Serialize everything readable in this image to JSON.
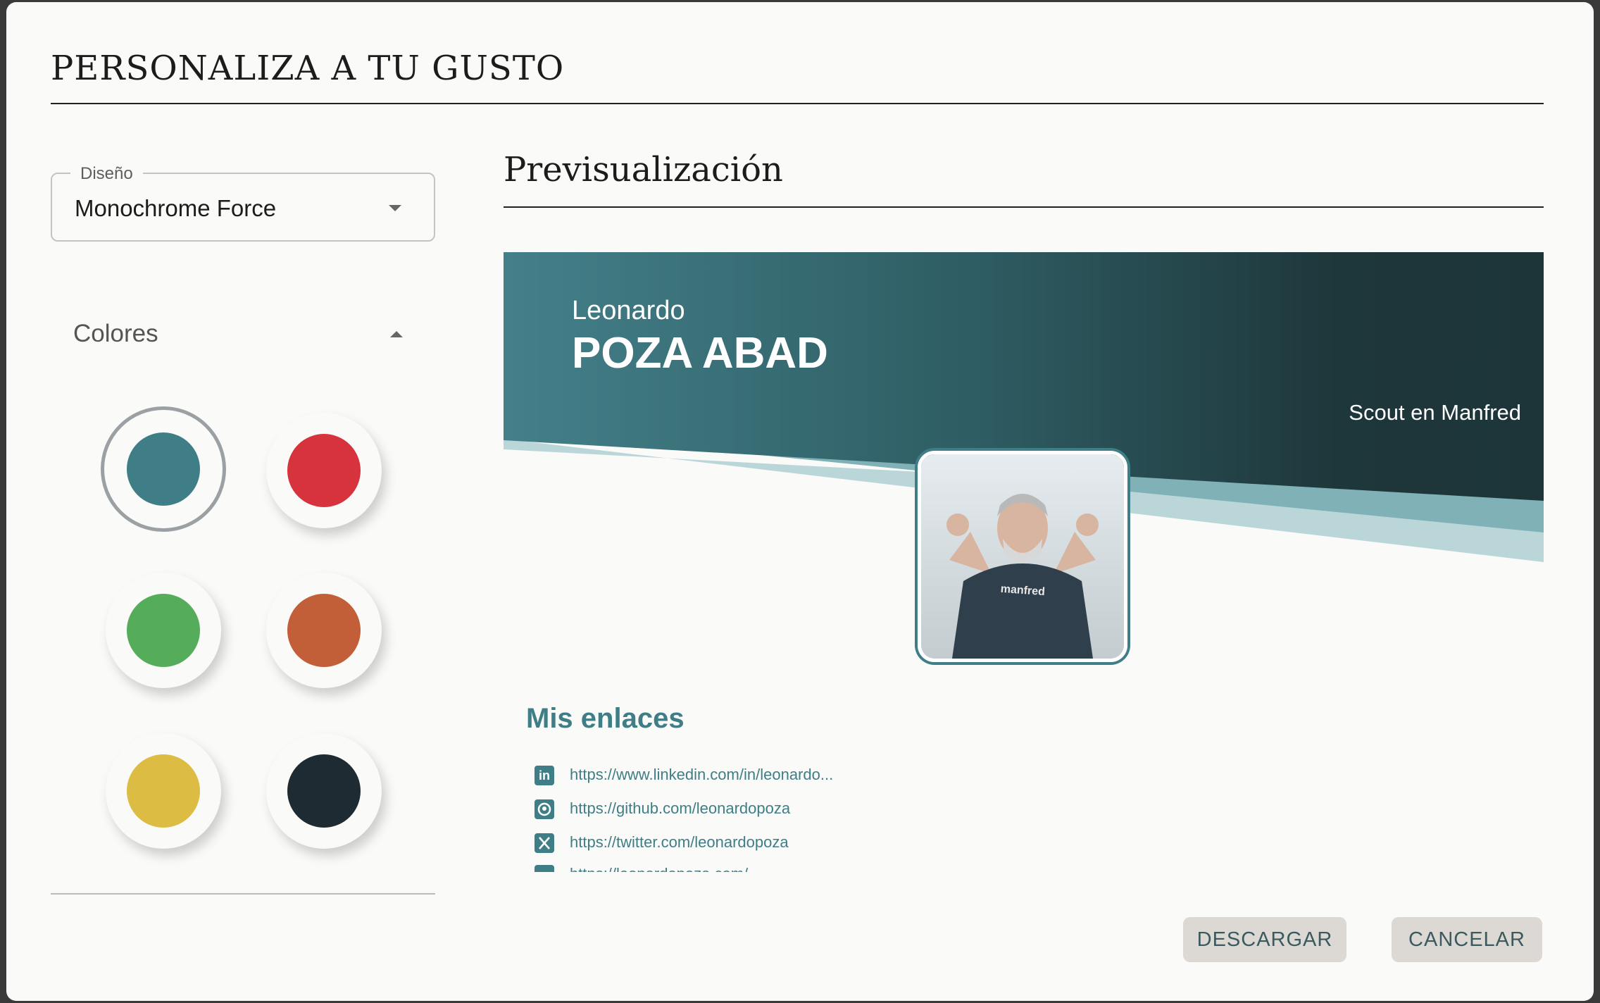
{
  "dialog": {
    "title": "PERSONALIZA A TU GUSTO"
  },
  "design_select": {
    "label": "Diseño",
    "value": "Monochrome Force"
  },
  "colors": {
    "title": "Colores",
    "swatches": [
      {
        "name": "teal",
        "hex": "#3f7e86",
        "selected": true
      },
      {
        "name": "red",
        "hex": "#d6333c",
        "selected": false
      },
      {
        "name": "green",
        "hex": "#55ad5b",
        "selected": false
      },
      {
        "name": "orange",
        "hex": "#c25e38",
        "selected": false
      },
      {
        "name": "yellow",
        "hex": "#dcbc42",
        "selected": false
      },
      {
        "name": "navy",
        "hex": "#1f2b33",
        "selected": false
      }
    ]
  },
  "preview": {
    "title": "Previsualización",
    "first_name": "Leonardo",
    "last_name": "POZA ABAD",
    "role": "Scout en Manfred",
    "shirt_text": "manfred",
    "links_heading": "Mis enlaces",
    "links": [
      {
        "icon": "linkedin-icon",
        "url": "https://www.linkedin.com/in/leonardo..."
      },
      {
        "icon": "github-icon",
        "url": "https://github.com/leonardopoza"
      },
      {
        "icon": "x-twitter-icon",
        "url": "https://twitter.com/leonardopoza"
      },
      {
        "icon": "link-icon",
        "url": "https://leonardopoza.com/"
      }
    ]
  },
  "actions": {
    "download": "DESCARGAR",
    "cancel": "CANCELAR"
  },
  "theme": {
    "accent": "#3f7e86",
    "banner_dark": "#1d3538",
    "band_light": "#bad6d9",
    "band_mid": "#7fb1b6"
  }
}
